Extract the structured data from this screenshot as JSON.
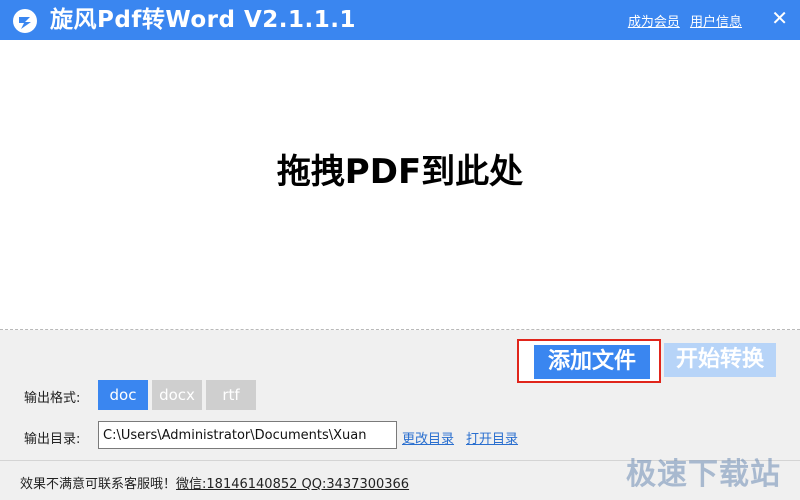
{
  "window": {
    "title": "旋风Pdf转Word  V2.1.1.1",
    "links": {
      "member": "成为会员",
      "user_info": "用户信息"
    },
    "close_glyph": "✕"
  },
  "dropzone": {
    "text": "拖拽PDF到此处"
  },
  "buttons": {
    "add_file": "添加文件",
    "start_convert": "开始转换"
  },
  "output_format": {
    "label": "输出格式:",
    "options": [
      "doc",
      "docx",
      "rtf"
    ],
    "selected": "doc"
  },
  "output_dir": {
    "label": "输出目录:",
    "value": "C:\\Users\\Administrator\\Documents\\Xuan",
    "change_link": "更改目录",
    "open_link": "打开目录"
  },
  "footer": {
    "text": "效果不满意可联系客服哦！",
    "contact": "微信:18146140852 QQ:3437300366"
  },
  "watermark": "极速下载站",
  "colors": {
    "accent": "#3a86f0",
    "disabled_button": "#b7d4f8",
    "highlight_border": "#e0251b"
  },
  "icons": {
    "logo": "app-logo-icon",
    "close": "close-icon"
  }
}
